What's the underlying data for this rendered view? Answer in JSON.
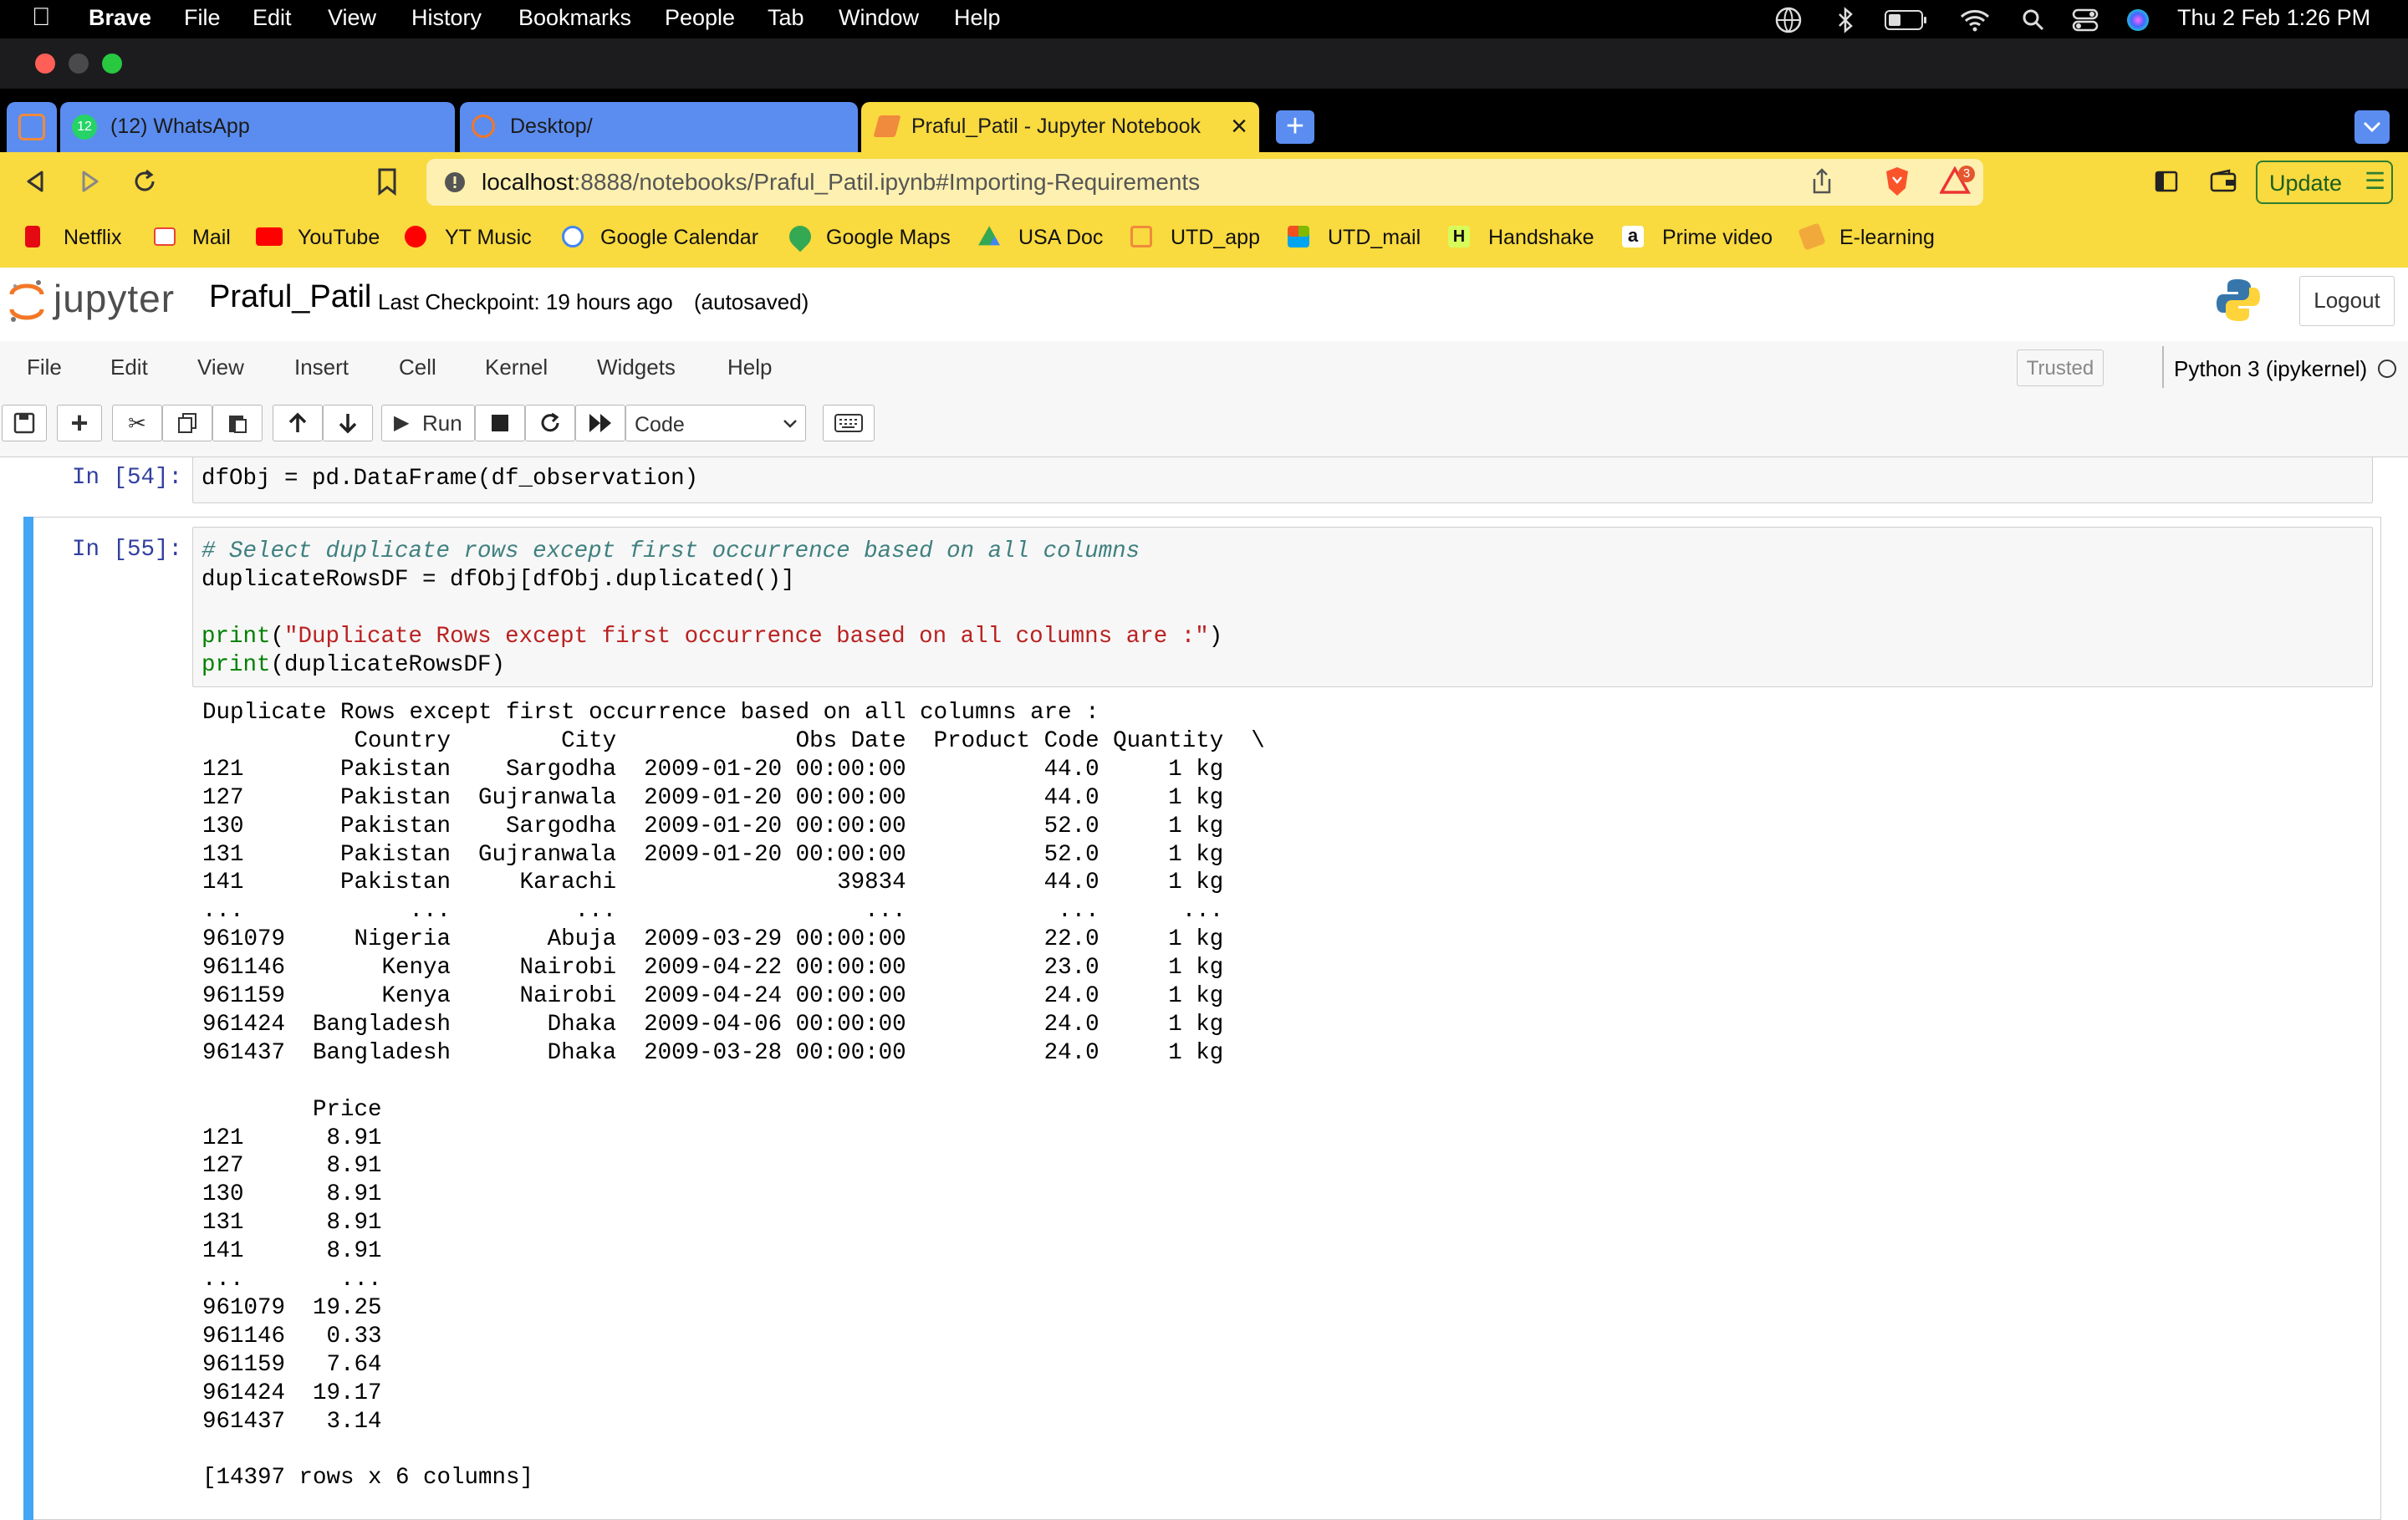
{
  "menubar": {
    "app": "Brave",
    "items": [
      "File",
      "Edit",
      "View",
      "History",
      "Bookmarks",
      "People",
      "Tab",
      "Window",
      "Help"
    ],
    "clock": "Thu 2 Feb  1:26 PM"
  },
  "tabs": [
    {
      "label": "(12) WhatsApp",
      "badge": "12"
    },
    {
      "label": "Desktop/"
    },
    {
      "label": "Praful_Patil - Jupyter Notebook",
      "close": "×"
    }
  ],
  "newtab": "+",
  "address": {
    "host": "localhost",
    "rest": ":8888/notebooks/Praful_Patil.ipynb#Importing-Requirements"
  },
  "alerts_badge": "3",
  "update_label": "Update",
  "bookmarks": [
    "Netflix",
    "Mail",
    "YouTube",
    "YT Music",
    "Google Calendar",
    "Google Maps",
    "USA Doc",
    "UTD_app",
    "UTD_mail",
    "Handshake",
    "Prime video",
    "E-learning"
  ],
  "jupyter": {
    "logo": "jupyter",
    "notebook_name": "Praful_Patil",
    "checkpoint": "Last Checkpoint: 19 hours ago",
    "autosave": "(autosaved)",
    "logout": "Logout",
    "menu": [
      "File",
      "Edit",
      "View",
      "Insert",
      "Cell",
      "Kernel",
      "Widgets",
      "Help"
    ],
    "trusted": "Trusted",
    "kernel": "Python 3 (ipykernel)",
    "run_label": "Run",
    "cell_type": "Code"
  },
  "cells": [
    {
      "prompt": "In [54]:",
      "code": [
        "dfObj = pd.DataFrame(df_observation)"
      ]
    },
    {
      "prompt": "In [55]:",
      "code_comment": "# Select duplicate rows except first occurrence based on all columns",
      "code_line2": "duplicateRowsDF = dfObj[dfObj.duplicated()]",
      "print1_fn": "print",
      "print1_str": "\"Duplicate Rows except first occurrence based on all columns are :\"",
      "print2_fn": "print",
      "print2_arg": "(duplicateRowsDF)",
      "output": [
        "Duplicate Rows except first occurrence based on all columns are :",
        "           Country        City             Obs Date  Product Code Quantity  \\",
        "121       Pakistan    Sargodha  2009-01-20 00:00:00          44.0     1 kg  ",
        "127       Pakistan  Gujranwala  2009-01-20 00:00:00          44.0     1 kg  ",
        "130       Pakistan    Sargodha  2009-01-20 00:00:00          52.0     1 kg  ",
        "131       Pakistan  Gujranwala  2009-01-20 00:00:00          52.0     1 kg  ",
        "141       Pakistan     Karachi                39834          44.0     1 kg  ",
        "...            ...         ...                  ...           ...      ...  ",
        "961079     Nigeria       Abuja  2009-03-29 00:00:00          22.0     1 kg  ",
        "961146       Kenya     Nairobi  2009-04-22 00:00:00          23.0     1 kg  ",
        "961159       Kenya     Nairobi  2009-04-24 00:00:00          24.0     1 kg  ",
        "961424  Bangladesh       Dhaka  2009-04-06 00:00:00          24.0     1 kg  ",
        "961437  Bangladesh       Dhaka  2009-03-28 00:00:00          24.0     1 kg  ",
        "",
        "        Price  ",
        "121      8.91  ",
        "127      8.91  ",
        "130      8.91  ",
        "131      8.91  ",
        "141      8.91  ",
        "...       ...  ",
        "961079  19.25  ",
        "961146   0.33  ",
        "961159   7.64  ",
        "961424  19.17  ",
        "961437   3.14  ",
        "",
        "[14397 rows x 6 columns]"
      ]
    }
  ]
}
